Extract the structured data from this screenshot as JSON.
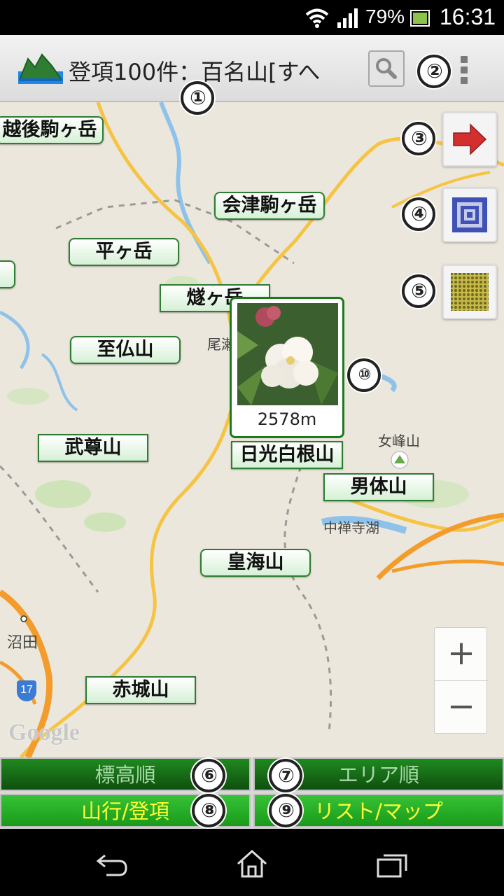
{
  "status_bar": {
    "battery_percent": "79%",
    "time": "16:31"
  },
  "action_bar": {
    "title": "登項100件：百名山[すへ"
  },
  "badges": [
    "①",
    "②",
    "③",
    "④",
    "⑤",
    "⑥",
    "⑦",
    "⑧",
    "⑨",
    "⑩"
  ],
  "map": {
    "peaks": [
      {
        "name": "越後駒ヶ岳"
      },
      {
        "name": "会津駒ヶ岳"
      },
      {
        "name": "平ヶ岳"
      },
      {
        "name": "燧ヶ岳"
      },
      {
        "name": "至仏山"
      },
      {
        "name": "武尊山"
      },
      {
        "name": "日光白根山"
      },
      {
        "name": "男体山"
      },
      {
        "name": "皇海山"
      },
      {
        "name": "赤城山"
      }
    ],
    "places": [
      "尾瀬",
      "女峰山",
      "中禅寺湖",
      "沼田",
      "17"
    ],
    "popup": {
      "elevation": "2578m"
    },
    "zoom_in": "+",
    "zoom_out": "−",
    "attribution": "Google"
  },
  "buttons": {
    "sort_elevation": "標高順",
    "sort_area": "エリア順",
    "climb_summit": "山行/登項",
    "list_map": "リスト/マップ"
  },
  "colors": {
    "accent": "#1b7a1b",
    "highlight": "#ffff33"
  },
  "icons": [
    "wifi-icon",
    "signal-icon",
    "battery-icon",
    "mountain-logo-icon",
    "search-icon",
    "overflow-menu-icon",
    "arrow-right-icon",
    "concentric-square-icon",
    "grid-icon",
    "back-icon",
    "home-icon",
    "recents-icon"
  ]
}
